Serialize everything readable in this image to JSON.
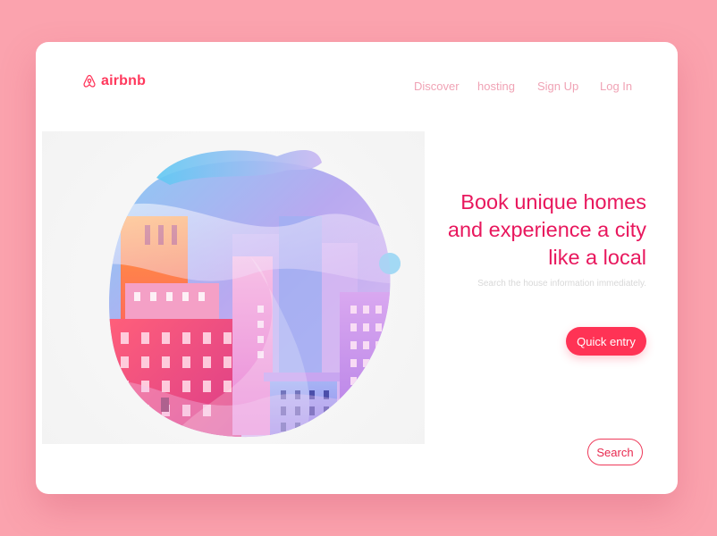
{
  "brand": {
    "name": "airbnb",
    "color": "#ff385c"
  },
  "nav": {
    "items": [
      {
        "label": "Discover"
      },
      {
        "label": "hosting"
      },
      {
        "label": "Sign Up"
      },
      {
        "label": "Log In"
      }
    ]
  },
  "hero": {
    "headline_lines": [
      "Book unique homes",
      "and experience a city",
      "like a local"
    ],
    "subtext": "Search the house information immediately.",
    "primary_button": "Quick entry",
    "secondary_button": "Search"
  },
  "colors": {
    "page_background": "#fba3ae",
    "card_background": "#ffffff",
    "accent": "#ff3355",
    "headline": "#e8175d",
    "nav_text": "#f0a3b5",
    "subtext": "#d8d8d8"
  },
  "icons": {
    "logo": "airbnb-belo-icon"
  }
}
